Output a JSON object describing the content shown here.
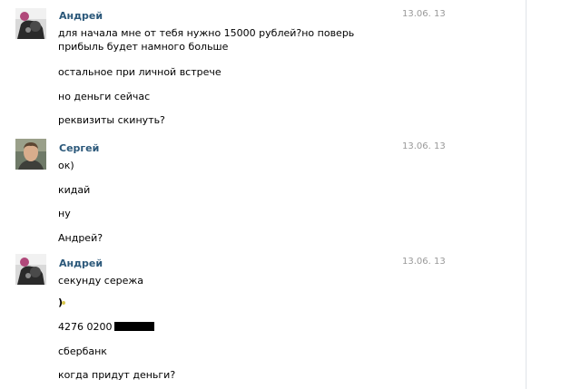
{
  "conversation": {
    "blocks": [
      {
        "sender": "Андрей",
        "date": "13.06. 13",
        "avatar": "avatar-photo-andrey",
        "messages": [
          "для начала мне от тебя нужно 15000 рублей?но поверь прибыль будет намного больше",
          "остальное при личной встрече",
          "но деньги сейчас",
          "реквизиты скинуть?"
        ]
      },
      {
        "sender": "Сергей",
        "date": "13.06. 13",
        "avatar": "avatar-photo-sergey",
        "messages": [
          "ок)",
          "кидай",
          "ну",
          "Андрей?"
        ]
      },
      {
        "sender": "Андрей",
        "date": "13.06. 13",
        "avatar": "avatar-photo-andrey",
        "messages": [
          "секунду сережа",
          ")",
          "4276 0200",
          "сбербанк",
          "когда придут деньги?"
        ]
      }
    ]
  },
  "colors": {
    "sender_name": "#2b587a",
    "date_text": "#999999",
    "divider": "#dfe3e8",
    "redaction": "#000000",
    "smile_dot": "#d8c64f"
  },
  "icons": {
    "redaction_bar": "black-redaction-bar",
    "smile_marker": "smiley-icon"
  }
}
